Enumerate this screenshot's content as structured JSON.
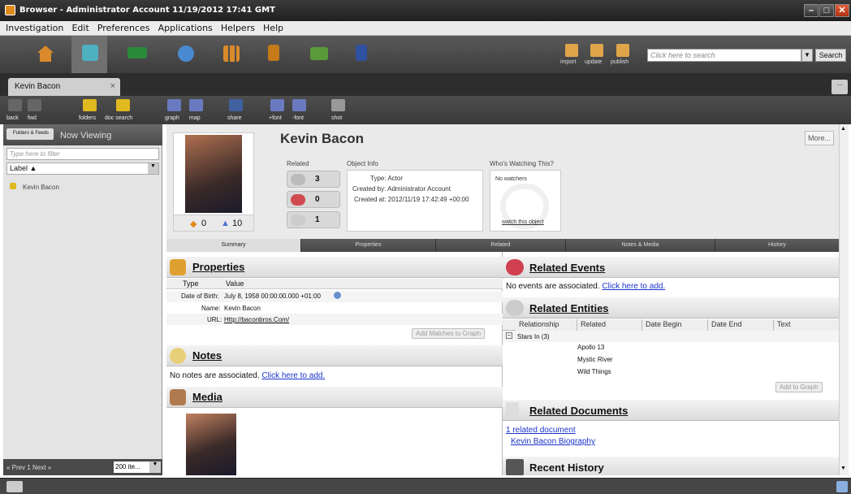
{
  "window": {
    "title": "Browser - Administrator Account 11/19/2012 17:41 GMT"
  },
  "menu": [
    "Investigation",
    "Edit",
    "Preferences",
    "Applications",
    "Helpers",
    "Help"
  ],
  "app_toolbar": {
    "actions": [
      "import",
      "update",
      "publish"
    ],
    "search_placeholder": "Click here to search",
    "search_button": "Search"
  },
  "tab": {
    "label": "Kevin Bacon",
    "close": "×",
    "more": "..."
  },
  "sub_toolbar": [
    "back",
    "fwd",
    "folders",
    "doc search",
    "graph",
    "map",
    "share",
    "+font",
    "-font",
    "shot"
  ],
  "sidebar": {
    "folders_button": "Folders & Feeds",
    "now_viewing": "Now Viewing",
    "filter_placeholder": "Type here to filter",
    "sort_label": "Label ▲",
    "items": [
      "Kevin Bacon"
    ],
    "pager": "« Prev  1  Next »",
    "page_size": "200 ite..."
  },
  "entity": {
    "name": "Kevin Bacon",
    "more_button": "More...",
    "down_votes": "0",
    "up_votes": "10",
    "related_label": "Related",
    "related_counts": [
      "3",
      "0",
      "1"
    ],
    "object_info_label": "Object Info",
    "object_info": {
      "type": "Type: Actor",
      "created_by": "Created by: Administrator Account",
      "created_at": "Created at: 2012/11/19 17:42:49 +00:00"
    },
    "watching_label": "Who's Watching This?",
    "watchers": "No watchers",
    "watch_link": "watch this object"
  },
  "subtabs": [
    "Summary",
    "Properties",
    "Related",
    "Notes & Media",
    "History"
  ],
  "properties": {
    "title": "Properties",
    "columns": [
      "Type",
      "Value"
    ],
    "rows": [
      {
        "key": "Date of Birth:",
        "value": "July 8, 1958 00:00:00.000 +01:00"
      },
      {
        "key": "Name:",
        "value": "Kevin Bacon"
      },
      {
        "key": "URL:",
        "value": "Http://baconbros.Com/"
      }
    ],
    "add_button": "Add Matches to Graph"
  },
  "notes": {
    "title": "Notes",
    "empty_text": "No notes are associated.",
    "add_link": "Click here to add."
  },
  "media": {
    "title": "Media"
  },
  "related_events": {
    "title": "Related Events",
    "empty_text": "No events are associated.",
    "add_link": "Click here to add."
  },
  "related_entities": {
    "title": "Related Entities",
    "columns": [
      "Relationship",
      "Related",
      "Date Begin",
      "Date End",
      "Text"
    ],
    "group": "Stars In (3)",
    "items": [
      "Apollo 13",
      "Mystic River",
      "Wild Things"
    ],
    "add_button": "Add to Graph"
  },
  "related_documents": {
    "title": "Related Documents",
    "count_link": "1 related document",
    "doc_link": "Kevin Bacon Biography"
  },
  "recent_history": {
    "title": "Recent History"
  },
  "colors": {
    "accent_orange": "#e08a1c",
    "link_blue": "#1a33cc",
    "toolbar_dark": "#3c3c3c"
  }
}
